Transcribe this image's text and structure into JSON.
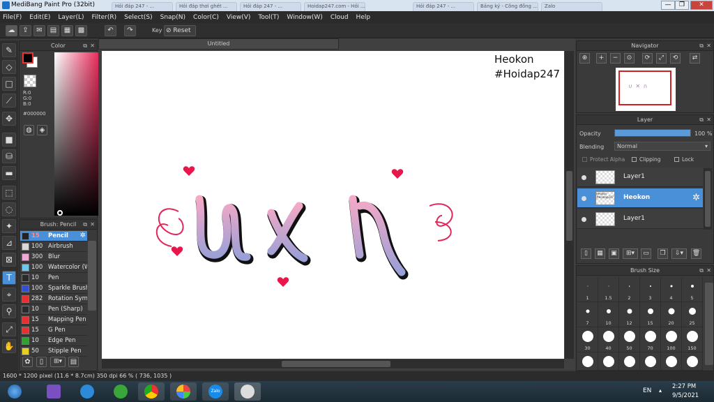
{
  "window": {
    "title": "MediBang Paint Pro (32bit)",
    "browser_tabs": [
      "Hỏi đáp 247 - ...",
      "Hỏi đáp thơi ghét ...",
      "Hỏi đáp 247 - ...",
      "Hoidap247.com - Hỏi ...",
      "Hỏi đáp 247 - ...",
      "Bảng ký - Công đồng ...",
      "Zalo"
    ],
    "controls": {
      "minimize": "—",
      "maximize": "❐",
      "close": "✕"
    }
  },
  "menu": [
    "File(F)",
    "Edit(E)",
    "Layer(L)",
    "Filter(R)",
    "Select(S)",
    "Snap(N)",
    "Color(C)",
    "View(V)",
    "Tool(T)",
    "Window(W)",
    "Cloud",
    "Help"
  ],
  "toolbar": {
    "key_label": "Key",
    "reset_label": "Reset"
  },
  "color_panel": {
    "title": "Color",
    "r": "R:0",
    "g": "G:0",
    "b": "B:0",
    "hex": "#000000",
    "primary_color": "#000000",
    "secondary_color": "#ffffff",
    "accent": "#e8164b"
  },
  "brush_panel": {
    "title": "Brush: Pencil",
    "items": [
      {
        "size": "15",
        "name": "Pencil",
        "color": "#222222",
        "selected": true
      },
      {
        "size": "100",
        "name": "Airbrush",
        "color": "#d9d9d9"
      },
      {
        "size": "300",
        "name": "Blur",
        "color": "#f0a8d8"
      },
      {
        "size": "100",
        "name": "Watercolor (W",
        "color": "#6cc8f0"
      },
      {
        "size": "10",
        "name": "Pen",
        "color": "#2a2a2a"
      },
      {
        "size": "100",
        "name": "Sparkle Brush",
        "color": "#3050d8"
      },
      {
        "size": "282",
        "name": "Rotation Sym",
        "color": "#e83030"
      },
      {
        "size": "10",
        "name": "Pen (Sharp)",
        "color": "#2a2a2a"
      },
      {
        "size": "15",
        "name": "Mapping Pen",
        "color": "#e83030"
      },
      {
        "size": "15",
        "name": "G Pen",
        "color": "#e83030"
      },
      {
        "size": "10",
        "name": "Edge Pen",
        "color": "#30a030"
      },
      {
        "size": "50",
        "name": "Stipple Pen",
        "color": "#e8d020"
      }
    ]
  },
  "canvas": {
    "doc_tab": "Untitled",
    "text_line1": "Heokon",
    "text_line2": "#Hoidap247"
  },
  "navigator": {
    "title": "Navigator"
  },
  "layer_panel": {
    "title": "Layer",
    "opacity_label": "Opacity",
    "opacity_value": "100 %",
    "opacity_fraction": 1.0,
    "blending_label": "Blending",
    "blending_value": "Normal",
    "protect_alpha": "Protect Alpha",
    "clipping": "Clipping",
    "lock": "Lock",
    "layers": [
      {
        "name": "Layer1",
        "selected": false
      },
      {
        "name": "Heokon",
        "selected": true,
        "thumb_text": "Heokon #Hoidap247"
      },
      {
        "name": "Layer1",
        "selected": false
      }
    ]
  },
  "brush_size": {
    "title": "Brush Size",
    "sizes": [
      "1",
      "1.5",
      "2",
      "3",
      "4",
      "5",
      "7",
      "10",
      "12",
      "15",
      "20",
      "25",
      "30",
      "40",
      "50",
      "70",
      "100",
      "150"
    ]
  },
  "status": {
    "text": "1600 * 1200 pixel   (11.6 * 8.7cm)   350 dpi   66 %   ( 736, 1035 )"
  },
  "taskbar": {
    "lang": "EN",
    "time": "2:27 PM",
    "date": "9/5/2021"
  }
}
